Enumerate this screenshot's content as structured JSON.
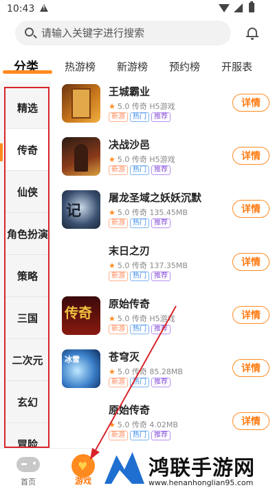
{
  "status_bar": {
    "time": "10:43"
  },
  "search": {
    "placeholder": "请输入关键字进行搜索"
  },
  "tabs": [
    "分类",
    "热游榜",
    "新游榜",
    "预约榜",
    "开服表"
  ],
  "sidebar": {
    "items": [
      "精选",
      "传奇",
      "仙侠",
      "角色扮演",
      "策略",
      "三国",
      "二次元",
      "玄幻",
      "冒险"
    ],
    "active": "传奇"
  },
  "tag_labels": {
    "new": "新游",
    "hot": "热门",
    "rec": "推荐"
  },
  "detail_label": "详情",
  "games": [
    {
      "name": "王城霸业",
      "rating": "5.0",
      "category": "传奇",
      "extra": "H5游戏"
    },
    {
      "name": "决战沙邑",
      "rating": "5.0",
      "category": "传奇",
      "extra": "H5游戏"
    },
    {
      "name": "屠龙圣域之妖妖沉默",
      "rating": "5.0",
      "category": "传奇",
      "extra": "135.45MB"
    },
    {
      "name": "末日之刃",
      "rating": "5.0",
      "category": "传奇",
      "extra": "137.35MB"
    },
    {
      "name": "原始传奇",
      "rating": "5.0",
      "category": "传奇",
      "extra": "H5游戏"
    },
    {
      "name": "苍穹灭",
      "rating": "5.0",
      "category": "传奇",
      "extra": "85.28MB"
    },
    {
      "name": "原始传奇",
      "rating": "5.0",
      "category": "传奇",
      "extra": "4.02MB"
    }
  ],
  "bottom_nav": {
    "home": "首页",
    "games": "游戏"
  },
  "watermark": {
    "title": "鸿联手游网",
    "url": "www.henanhonglian95.com"
  },
  "colors": {
    "accent": "#ff8a1f",
    "annotation": "#d9232a"
  }
}
